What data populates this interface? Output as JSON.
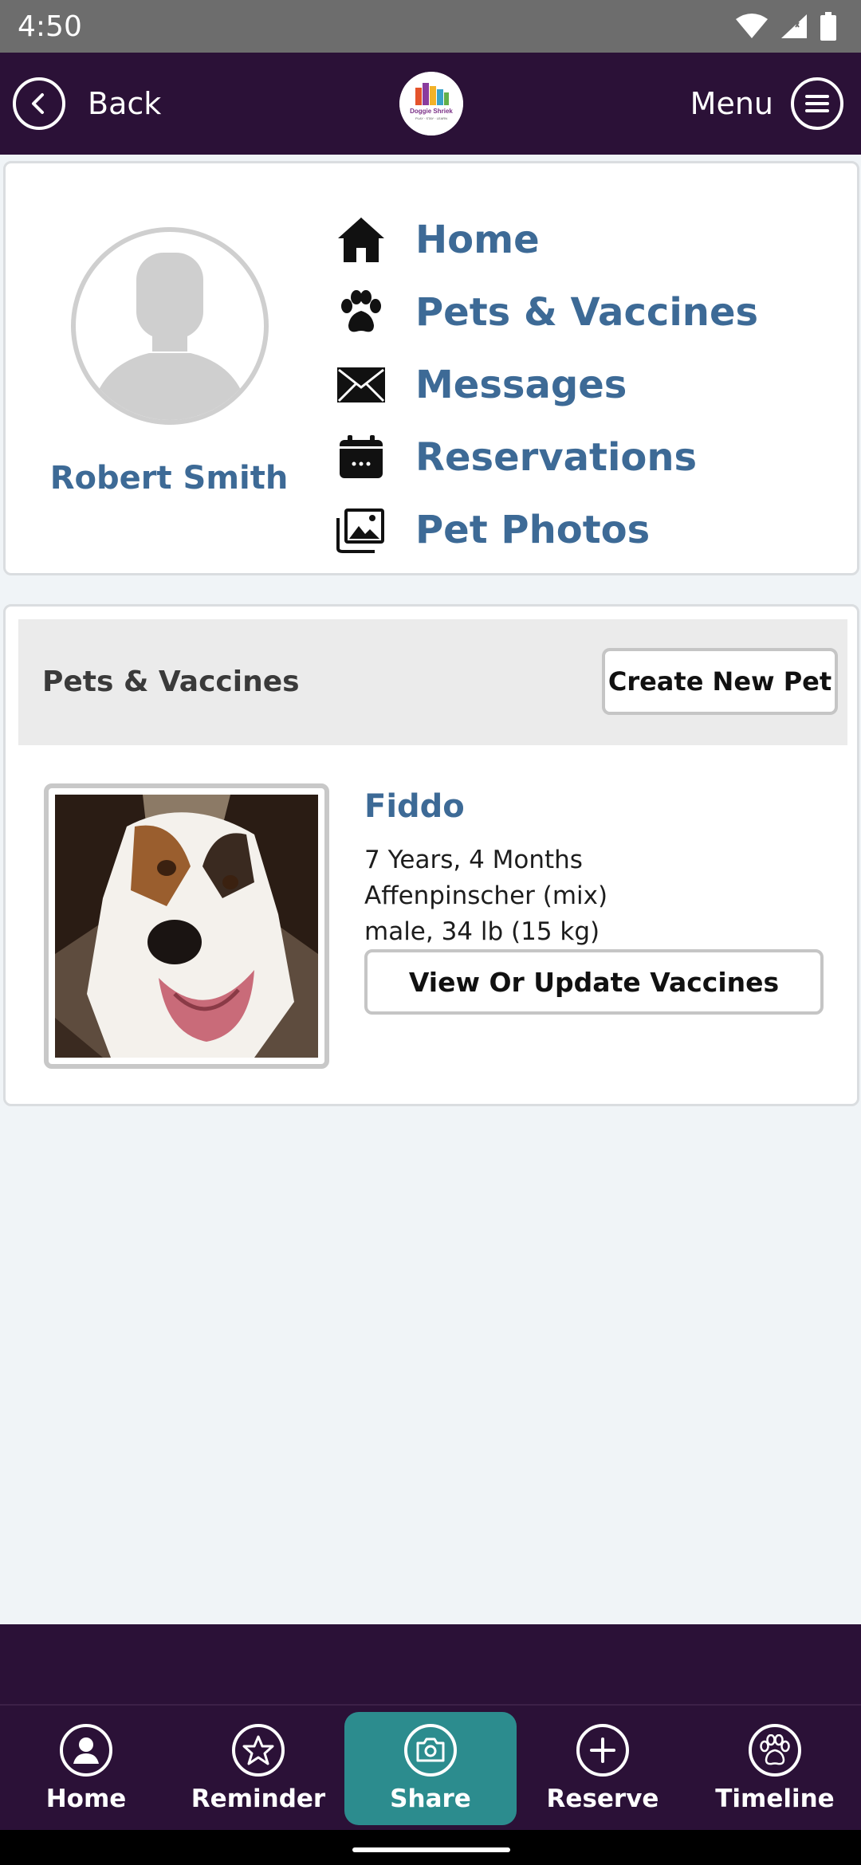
{
  "status_bar": {
    "time": "4:50"
  },
  "top_bar": {
    "back_label": "Back",
    "menu_label": "Menu",
    "logo_text": "Doggie Shriek"
  },
  "profile": {
    "user_name": "Robert Smith",
    "nav_items": [
      {
        "label": "Home",
        "icon": "house-icon"
      },
      {
        "label": "Pets & Vaccines",
        "icon": "paw-icon"
      },
      {
        "label": "Messages",
        "icon": "envelope-icon"
      },
      {
        "label": "Reservations",
        "icon": "calendar-icon"
      },
      {
        "label": "Pet Photos",
        "icon": "photos-icon"
      }
    ]
  },
  "pets_section": {
    "title": "Pets & Vaccines",
    "create_button": "Create New Pet",
    "pet": {
      "name": "Fiddo",
      "age": "7 Years, 4 Months",
      "breed": "Affenpinscher (mix)",
      "sex_weight": "male, 34 lb (15 kg)",
      "vaccines_button": "View Or Update Vaccines"
    }
  },
  "bottom_nav": [
    {
      "label": "Home",
      "icon": "person-icon"
    },
    {
      "label": "Reminder",
      "icon": "star-icon"
    },
    {
      "label": "Share",
      "icon": "camera-icon",
      "active": true
    },
    {
      "label": "Reserve",
      "icon": "plus-icon"
    },
    {
      "label": "Timeline",
      "icon": "paw-icon"
    }
  ],
  "colors": {
    "brand_dark": "#2b1137",
    "accent_teal": "#2c8c8e",
    "link_blue": "#3d6a96",
    "background": "#f0f4f7"
  }
}
